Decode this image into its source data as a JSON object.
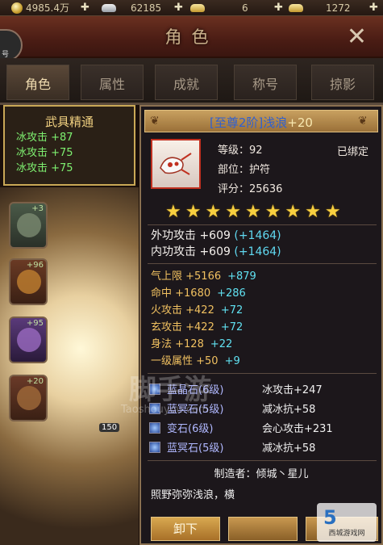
{
  "resources": {
    "coins": "4985.4万",
    "silver": "62185",
    "gold": "6",
    "ingot": "1272"
  },
  "header": {
    "title": "角色",
    "avatar_label": "号"
  },
  "tabs": [
    "角色",
    "属性",
    "成就",
    "称号",
    "掠影"
  ],
  "mastery": {
    "title": "武具精通",
    "lines": [
      "冰攻击 +87",
      "冰攻击 +75",
      "冰攻击 +75"
    ]
  },
  "slots": [
    {
      "level": "+3"
    },
    {
      "level": "+96"
    },
    {
      "level": "+95"
    },
    {
      "level": "+20"
    }
  ],
  "scene_badge": "150",
  "item": {
    "tier": "[至尊2阶]",
    "name": "浅浪",
    "enhance": "+20",
    "bound": "已绑定",
    "level": "等级：92",
    "slot": "部位：护符",
    "score": "评分：25636",
    "stars": 9
  },
  "main_stats": [
    {
      "label": "外功攻击 +609",
      "bonus": "(+1464)"
    },
    {
      "label": "内功攻击 +609",
      "bonus": "(+1464)"
    }
  ],
  "attributes": [
    {
      "label": "气上限 +5166",
      "bonus": "+879"
    },
    {
      "label": "命中 +1680",
      "bonus": "+286"
    },
    {
      "label": "火攻击 +422",
      "bonus": "+72"
    },
    {
      "label": "玄攻击 +422",
      "bonus": "+72"
    },
    {
      "label": "身法 +128",
      "bonus": "+22"
    },
    {
      "label": "一级属性 +50",
      "bonus": "+9"
    }
  ],
  "gems": [
    {
      "name": "蓝晶石(6级)",
      "effect": "冰攻击+247"
    },
    {
      "name": "蓝冥石(5级)",
      "effect": "减冰抗+58"
    },
    {
      "name": "变石(6级)",
      "effect": "会心攻击+231"
    },
    {
      "name": "蓝冥石(5级)",
      "effect": "减冰抗+58"
    }
  ],
  "maker": "制造者：倾城丶星儿",
  "description": "照野弥弥浅浪，横",
  "buttons": {
    "unequip": "卸下"
  },
  "watermark": {
    "main": "脚手游",
    "sub": "Taoshouyou.com"
  },
  "logo": {
    "mark": "5",
    "text": "西城游戏网"
  },
  "colors": {
    "border_gold": "#c9a856",
    "bonus_cyan": "#60d8f0",
    "attr_gold": "#f0c060",
    "star": "#f8d040"
  }
}
